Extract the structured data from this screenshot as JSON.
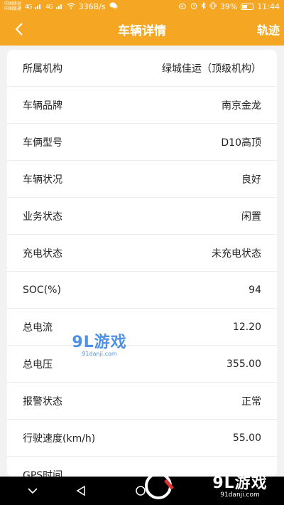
{
  "status_bar": {
    "carrier_1": "中国移动",
    "carrier_2": "中国联通",
    "network_1": "4G",
    "network_2": "4G",
    "speed": "336B/s",
    "battery": "39%",
    "time": "11:44"
  },
  "header": {
    "title": "车辆详情",
    "action_label": "轨迹"
  },
  "details": [
    {
      "label": "所属机构",
      "value": "绿城佳运（顶级机构）"
    },
    {
      "label": "车辆品牌",
      "value": "南京金龙"
    },
    {
      "label": "车俩型号",
      "value": "D10高顶"
    },
    {
      "label": "车辆状况",
      "value": "良好"
    },
    {
      "label": "业务状态",
      "value": "闲置"
    },
    {
      "label": "充电状态",
      "value": "未充电状态"
    },
    {
      "label": "SOC(%)",
      "value": "94"
    },
    {
      "label": "总电流",
      "value": "12.20"
    },
    {
      "label": "总电压",
      "value": "355.00"
    },
    {
      "label": "报警状态",
      "value": "正常"
    },
    {
      "label": "行驶速度(km/h)",
      "value": "55.00"
    },
    {
      "label": "GPS时间",
      "value": ""
    }
  ],
  "watermark": {
    "brand": "9L游戏",
    "site": "91danji.com"
  },
  "colors": {
    "accent": "#f5a623"
  }
}
